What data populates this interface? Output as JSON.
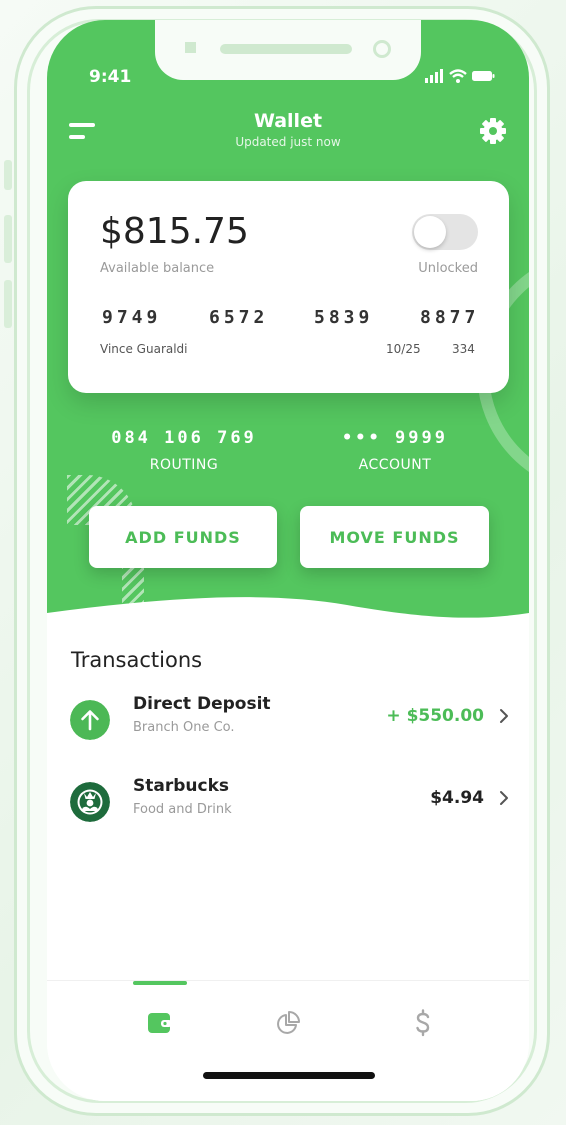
{
  "status_bar": {
    "time": "9:41"
  },
  "header": {
    "title": "Wallet",
    "subtitle": "Updated just now"
  },
  "card": {
    "balance": "$815.75",
    "balance_label": "Available balance",
    "lock_state": "Unlocked",
    "number_groups": [
      "9749",
      "6572",
      "5839",
      "8877"
    ],
    "holder": "Vince Guaraldi",
    "expiry": "10/25",
    "cvv": "334"
  },
  "accounts": {
    "routing_number": "084 106 769",
    "routing_label": "ROUTING",
    "account_number": "••• 9999",
    "account_label": "ACCOUNT"
  },
  "actions": {
    "add_funds": "ADD FUNDS",
    "move_funds": "MOVE FUNDS"
  },
  "transactions": {
    "title": "Transactions",
    "items": [
      {
        "name": "Direct Deposit",
        "category": "Branch One Co.",
        "amount": "+ $550.00",
        "icon": "arrow-up-icon"
      },
      {
        "name": "Starbucks",
        "category": "Food and Drink",
        "amount": "$4.94",
        "icon": "starbucks-logo-icon"
      }
    ]
  },
  "tabs": [
    {
      "icon": "wallet-icon",
      "active": true
    },
    {
      "icon": "pie-chart-icon",
      "active": false
    },
    {
      "icon": "dollar-icon",
      "active": false
    }
  ],
  "colors": {
    "accent": "#54c65f",
    "positive_amount": "#4cbc57",
    "background": "#eaf5ea"
  }
}
